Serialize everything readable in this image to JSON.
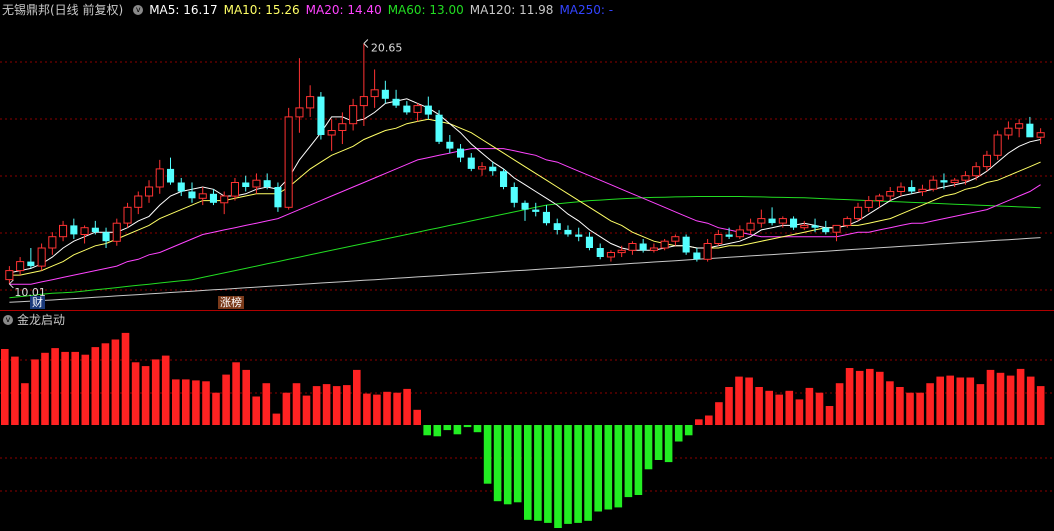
{
  "stock": {
    "title": "无锡鼎邦(日线 前复权)",
    "menu_glyph": "v"
  },
  "ma_labels": [
    {
      "text": "MA5: 16.17",
      "color": "#ffffff"
    },
    {
      "text": "MA10: 15.26",
      "color": "#ffff66"
    },
    {
      "text": "MA20: 14.40",
      "color": "#ff44ff"
    },
    {
      "text": "MA60: 13.00",
      "color": "#22dd22"
    },
    {
      "text": "MA120: 11.98",
      "color": "#c8c8c8"
    },
    {
      "text": "MA250: -",
      "color": "#3344ff"
    }
  ],
  "annotations": {
    "high_label": "20.65",
    "low_label": "10.01",
    "tag_cai": "财",
    "tag_zhangting": "涨榜"
  },
  "indicator": {
    "name": "金龙启动",
    "menu_glyph": "v"
  },
  "colors": {
    "up": "#ff3333",
    "down": "#54ffff",
    "grid": "#8b0000",
    "ma5": "#ffffff",
    "ma10": "#ffff66",
    "ma20": "#ff44ff",
    "ma60": "#22dd22",
    "ma120": "#c8c8c8",
    "hist_pos": "#ff2222",
    "hist_neg": "#22ee22"
  },
  "chart_data": [
    {
      "type": "candlestick",
      "title": "无锡鼎邦(日线 前复权)",
      "ylim": [
        9.3,
        21.6
      ],
      "ohlc": [
        [
          10.2,
          10.8,
          10.01,
          10.6
        ],
        [
          10.6,
          11.2,
          10.4,
          11.0
        ],
        [
          11.0,
          11.6,
          10.7,
          10.8
        ],
        [
          10.8,
          11.8,
          10.6,
          11.6
        ],
        [
          11.6,
          12.3,
          11.3,
          12.1
        ],
        [
          12.1,
          12.8,
          11.9,
          12.6
        ],
        [
          12.6,
          12.9,
          12.0,
          12.2
        ],
        [
          12.2,
          12.6,
          11.8,
          12.5
        ],
        [
          12.5,
          12.8,
          12.2,
          12.3
        ],
        [
          12.3,
          12.5,
          11.6,
          11.9
        ],
        [
          11.9,
          12.9,
          11.7,
          12.7
        ],
        [
          12.7,
          13.6,
          12.5,
          13.4
        ],
        [
          13.4,
          14.1,
          13.1,
          13.9
        ],
        [
          13.9,
          14.6,
          13.6,
          14.3
        ],
        [
          14.3,
          15.5,
          14.0,
          15.1
        ],
        [
          15.1,
          15.6,
          14.4,
          14.5
        ],
        [
          14.5,
          14.7,
          13.9,
          14.1
        ],
        [
          14.1,
          14.5,
          13.6,
          13.8
        ],
        [
          13.8,
          14.3,
          13.5,
          14.0
        ],
        [
          14.0,
          14.2,
          13.5,
          13.6
        ],
        [
          13.6,
          14.1,
          13.1,
          13.9
        ],
        [
          13.9,
          14.7,
          13.7,
          14.5
        ],
        [
          14.5,
          14.8,
          14.1,
          14.3
        ],
        [
          14.3,
          14.9,
          14.0,
          14.6
        ],
        [
          14.6,
          14.9,
          14.2,
          14.3
        ],
        [
          14.3,
          14.5,
          13.2,
          13.4
        ],
        [
          13.4,
          17.8,
          13.3,
          17.4
        ],
        [
          17.4,
          20.0,
          16.7,
          17.8
        ],
        [
          17.8,
          18.8,
          17.4,
          18.3
        ],
        [
          18.3,
          18.5,
          16.4,
          16.6
        ],
        [
          16.6,
          17.3,
          15.9,
          16.8
        ],
        [
          16.8,
          17.6,
          16.2,
          17.1
        ],
        [
          17.1,
          18.2,
          16.8,
          17.9
        ],
        [
          17.9,
          20.65,
          17.0,
          18.3
        ],
        [
          18.3,
          19.5,
          17.8,
          18.6
        ],
        [
          18.6,
          19.0,
          18.0,
          18.2
        ],
        [
          18.2,
          18.6,
          17.8,
          17.9
        ],
        [
          17.9,
          18.1,
          17.5,
          17.6
        ],
        [
          17.6,
          18.0,
          17.2,
          17.9
        ],
        [
          17.9,
          18.3,
          17.3,
          17.5
        ],
        [
          17.5,
          17.7,
          16.2,
          16.3
        ],
        [
          16.3,
          16.6,
          15.8,
          16.0
        ],
        [
          16.0,
          16.2,
          15.4,
          15.6
        ],
        [
          15.6,
          15.8,
          15.0,
          15.1
        ],
        [
          15.1,
          15.4,
          14.8,
          15.2
        ],
        [
          15.2,
          15.4,
          14.8,
          15.0
        ],
        [
          15.0,
          15.1,
          14.2,
          14.3
        ],
        [
          14.3,
          14.5,
          13.4,
          13.6
        ],
        [
          13.6,
          13.7,
          12.8,
          13.3
        ],
        [
          13.3,
          13.6,
          13.0,
          13.2
        ],
        [
          13.2,
          13.5,
          12.6,
          12.7
        ],
        [
          12.7,
          12.9,
          12.2,
          12.4
        ],
        [
          12.4,
          12.6,
          12.1,
          12.2
        ],
        [
          12.2,
          12.5,
          11.9,
          12.1
        ],
        [
          12.1,
          12.3,
          11.5,
          11.6
        ],
        [
          11.6,
          11.8,
          11.1,
          11.2
        ],
        [
          11.2,
          11.5,
          11.0,
          11.4
        ],
        [
          11.4,
          11.7,
          11.2,
          11.5
        ],
        [
          11.5,
          11.9,
          11.3,
          11.8
        ],
        [
          11.8,
          12.0,
          11.4,
          11.5
        ],
        [
          11.5,
          11.8,
          11.4,
          11.6
        ],
        [
          11.6,
          12.0,
          11.5,
          11.9
        ],
        [
          11.9,
          12.2,
          11.7,
          12.1
        ],
        [
          12.1,
          12.2,
          11.3,
          11.4
        ],
        [
          11.4,
          11.6,
          11.0,
          11.1
        ],
        [
          11.1,
          12.0,
          11.0,
          11.8
        ],
        [
          11.8,
          12.4,
          11.7,
          12.2
        ],
        [
          12.2,
          12.5,
          12.0,
          12.1
        ],
        [
          12.1,
          12.6,
          12.0,
          12.4
        ],
        [
          12.4,
          12.9,
          12.2,
          12.7
        ],
        [
          12.7,
          13.3,
          12.5,
          12.9
        ],
        [
          12.9,
          13.4,
          12.6,
          12.7
        ],
        [
          12.7,
          13.0,
          12.5,
          12.9
        ],
        [
          12.9,
          13.0,
          12.4,
          12.5
        ],
        [
          12.5,
          12.8,
          12.4,
          12.6
        ],
        [
          12.6,
          12.9,
          12.3,
          12.5
        ],
        [
          12.5,
          12.8,
          12.2,
          12.3
        ],
        [
          12.3,
          12.6,
          11.9,
          12.6
        ],
        [
          12.6,
          13.0,
          12.5,
          12.9
        ],
        [
          12.9,
          13.6,
          12.8,
          13.4
        ],
        [
          13.4,
          13.9,
          13.2,
          13.7
        ],
        [
          13.7,
          14.0,
          13.4,
          13.9
        ],
        [
          13.9,
          14.3,
          13.7,
          14.1
        ],
        [
          14.1,
          14.5,
          13.9,
          14.3
        ],
        [
          14.3,
          14.6,
          14.0,
          14.1
        ],
        [
          14.1,
          14.4,
          13.9,
          14.2
        ],
        [
          14.2,
          14.8,
          14.1,
          14.6
        ],
        [
          14.6,
          14.9,
          14.2,
          14.5
        ],
        [
          14.5,
          14.7,
          14.3,
          14.6
        ],
        [
          14.6,
          15.0,
          14.4,
          14.8
        ],
        [
          14.8,
          15.4,
          14.6,
          15.2
        ],
        [
          15.2,
          15.9,
          15.0,
          15.7
        ],
        [
          15.7,
          16.8,
          15.5,
          16.6
        ],
        [
          16.6,
          17.2,
          16.4,
          16.9
        ],
        [
          16.9,
          17.3,
          16.5,
          17.1
        ],
        [
          17.1,
          17.4,
          16.8,
          16.5
        ],
        [
          16.5,
          16.9,
          16.2,
          16.7
        ]
      ],
      "ma5": [
        10.5,
        10.6,
        10.7,
        10.9,
        11.2,
        11.6,
        11.9,
        12.1,
        12.3,
        12.3,
        12.3,
        12.5,
        12.8,
        13.0,
        13.5,
        13.9,
        14.1,
        14.2,
        14.3,
        14.2,
        13.9,
        13.9,
        14.0,
        14.2,
        14.3,
        14.2,
        14.7,
        15.5,
        16.1,
        16.7,
        17.4,
        17.4,
        17.2,
        17.3,
        17.6,
        18.0,
        18.1,
        18.2,
        18.0,
        17.8,
        17.5,
        17.1,
        16.7,
        16.2,
        15.8,
        15.4,
        15.1,
        14.7,
        14.4,
        14.1,
        13.8,
        13.5,
        13.1,
        12.8,
        12.4,
        12.1,
        11.8,
        11.6,
        11.5,
        11.5,
        11.5,
        11.6,
        11.7,
        11.7,
        11.6,
        11.6,
        11.7,
        11.8,
        11.9,
        12.1,
        12.4,
        12.5,
        12.6,
        12.6,
        12.7,
        12.6,
        12.5,
        12.5,
        12.6,
        12.8,
        13.1,
        13.4,
        13.7,
        13.9,
        14.0,
        14.1,
        14.2,
        14.3,
        14.4,
        14.5,
        14.7,
        15.0,
        15.4,
        15.8,
        16.1,
        16.3,
        16.4
      ],
      "ma10": [
        10.4,
        10.4,
        10.5,
        10.6,
        10.8,
        11.0,
        11.3,
        11.5,
        11.7,
        11.8,
        12.0,
        12.2,
        12.4,
        12.6,
        12.9,
        13.1,
        13.3,
        13.5,
        13.7,
        13.7,
        13.7,
        13.8,
        13.9,
        14.0,
        14.0,
        14.0,
        14.3,
        14.7,
        15.1,
        15.4,
        15.7,
        15.9,
        16.1,
        16.4,
        16.6,
        16.8,
        16.9,
        17.1,
        17.2,
        17.3,
        17.2,
        17.1,
        16.9,
        16.7,
        16.4,
        16.1,
        15.8,
        15.5,
        15.2,
        14.9,
        14.6,
        14.3,
        14.0,
        13.7,
        13.4,
        13.1,
        12.8,
        12.6,
        12.3,
        12.1,
        11.9,
        11.8,
        11.7,
        11.7,
        11.6,
        11.6,
        11.6,
        11.7,
        11.7,
        11.8,
        11.9,
        12.0,
        12.1,
        12.2,
        12.3,
        12.4,
        12.5,
        12.5,
        12.6,
        12.6,
        12.7,
        12.8,
        12.9,
        13.1,
        13.3,
        13.5,
        13.7,
        13.9,
        14.0,
        14.2,
        14.3,
        14.5,
        14.6,
        14.8,
        15.0,
        15.2,
        15.4
      ],
      "ma20": [
        10.0,
        10.0,
        10.0,
        10.1,
        10.2,
        10.3,
        10.4,
        10.5,
        10.6,
        10.7,
        10.8,
        11.0,
        11.1,
        11.3,
        11.4,
        11.6,
        11.8,
        12.0,
        12.2,
        12.3,
        12.4,
        12.5,
        12.6,
        12.7,
        12.8,
        12.9,
        13.1,
        13.3,
        13.5,
        13.7,
        13.9,
        14.1,
        14.3,
        14.5,
        14.7,
        14.9,
        15.1,
        15.3,
        15.5,
        15.6,
        15.7,
        15.8,
        15.9,
        16.0,
        16.0,
        16.0,
        16.0,
        15.9,
        15.8,
        15.7,
        15.5,
        15.4,
        15.2,
        15.0,
        14.8,
        14.6,
        14.4,
        14.2,
        14.0,
        13.8,
        13.6,
        13.4,
        13.2,
        13.0,
        12.8,
        12.7,
        12.5,
        12.4,
        12.3,
        12.2,
        12.1,
        12.1,
        12.1,
        12.1,
        12.1,
        12.1,
        12.1,
        12.1,
        12.2,
        12.3,
        12.3,
        12.4,
        12.5,
        12.6,
        12.7,
        12.7,
        12.8,
        12.9,
        13.0,
        13.1,
        13.2,
        13.3,
        13.5,
        13.7,
        13.9,
        14.1,
        14.4
      ],
      "ma60": [
        9.4,
        9.45,
        9.5,
        9.55,
        9.6,
        9.62,
        9.65,
        9.7,
        9.75,
        9.8,
        9.85,
        9.9,
        9.95,
        10.0,
        10.05,
        10.1,
        10.15,
        10.2,
        10.3,
        10.4,
        10.5,
        10.6,
        10.7,
        10.8,
        10.9,
        11.0,
        11.1,
        11.2,
        11.3,
        11.4,
        11.5,
        11.6,
        11.7,
        11.8,
        11.9,
        12.0,
        12.1,
        12.2,
        12.3,
        12.4,
        12.5,
        12.6,
        12.7,
        12.8,
        12.9,
        13.0,
        13.1,
        13.2,
        13.3,
        13.4,
        13.5,
        13.55,
        13.6,
        13.65,
        13.7,
        13.72,
        13.75,
        13.78,
        13.8,
        13.82,
        13.84,
        13.85,
        13.86,
        13.87,
        13.88,
        13.88,
        13.88,
        13.88,
        13.88,
        13.87,
        13.86,
        13.85,
        13.84,
        13.83,
        13.82,
        13.8,
        13.78,
        13.76,
        13.74,
        13.72,
        13.7,
        13.68,
        13.66,
        13.64,
        13.62,
        13.6,
        13.58,
        13.56,
        13.54,
        13.52,
        13.5,
        13.48,
        13.46,
        13.44,
        13.42,
        13.4,
        13.38
      ],
      "ma120": [
        9.2,
        9.22,
        9.25,
        9.28,
        9.3,
        9.33,
        9.36,
        9.39,
        9.42,
        9.45,
        9.48,
        9.51,
        9.54,
        9.57,
        9.6,
        9.63,
        9.66,
        9.69,
        9.72,
        9.75,
        9.78,
        9.81,
        9.84,
        9.87,
        9.9,
        9.93,
        9.96,
        9.99,
        10.02,
        10.05,
        10.08,
        10.11,
        10.14,
        10.17,
        10.2,
        10.23,
        10.26,
        10.29,
        10.32,
        10.35,
        10.38,
        10.41,
        10.44,
        10.47,
        10.5,
        10.53,
        10.56,
        10.59,
        10.62,
        10.65,
        10.68,
        10.71,
        10.74,
        10.77,
        10.8,
        10.83,
        10.86,
        10.89,
        10.92,
        10.95,
        10.98,
        11.01,
        11.04,
        11.07,
        11.1,
        11.13,
        11.16,
        11.19,
        11.22,
        11.25,
        11.28,
        11.31,
        11.34,
        11.37,
        11.4,
        11.43,
        11.46,
        11.49,
        11.52,
        11.55,
        11.58,
        11.61,
        11.64,
        11.67,
        11.7,
        11.73,
        11.76,
        11.79,
        11.82,
        11.85,
        11.88,
        11.91,
        11.94,
        11.97,
        12.0,
        12.03,
        12.06
      ]
    },
    {
      "type": "bar",
      "title": "金龙启动",
      "values": [
        8.0,
        7.2,
        4.4,
        6.9,
        7.6,
        8.1,
        7.7,
        7.7,
        7.4,
        8.2,
        8.6,
        9.0,
        9.7,
        6.6,
        6.2,
        6.9,
        7.3,
        4.8,
        4.8,
        4.7,
        4.6,
        3.4,
        5.3,
        6.6,
        5.8,
        3.0,
        4.4,
        1.2,
        3.4,
        4.4,
        3.1,
        4.1,
        4.3,
        4.1,
        4.2,
        5.8,
        3.3,
        3.2,
        3.5,
        3.4,
        3.8,
        1.6,
        -1.0,
        -1.1,
        -0.5,
        -0.9,
        -0.2,
        -0.7,
        -5.7,
        -7.4,
        -7.7,
        -7.5,
        -9.2,
        -9.3,
        -9.5,
        -10.0,
        -9.6,
        -9.5,
        -9.3,
        -8.4,
        -8.2,
        -8.0,
        -7.0,
        -6.8,
        -4.3,
        -3.4,
        -3.6,
        -1.6,
        -1.0,
        0.6,
        1.0,
        2.4,
        4.0,
        5.1,
        5.0,
        4.0,
        3.6,
        3.2,
        3.6,
        2.7,
        3.9,
        3.4,
        2.0,
        4.4,
        6.0,
        5.7,
        5.9,
        5.6,
        4.6,
        4.0,
        3.4,
        3.4,
        4.4,
        5.1,
        5.2,
        5.0,
        5.0,
        4.3,
        5.8,
        5.5,
        5.2,
        5.9,
        5.1,
        4.1
      ]
    }
  ]
}
